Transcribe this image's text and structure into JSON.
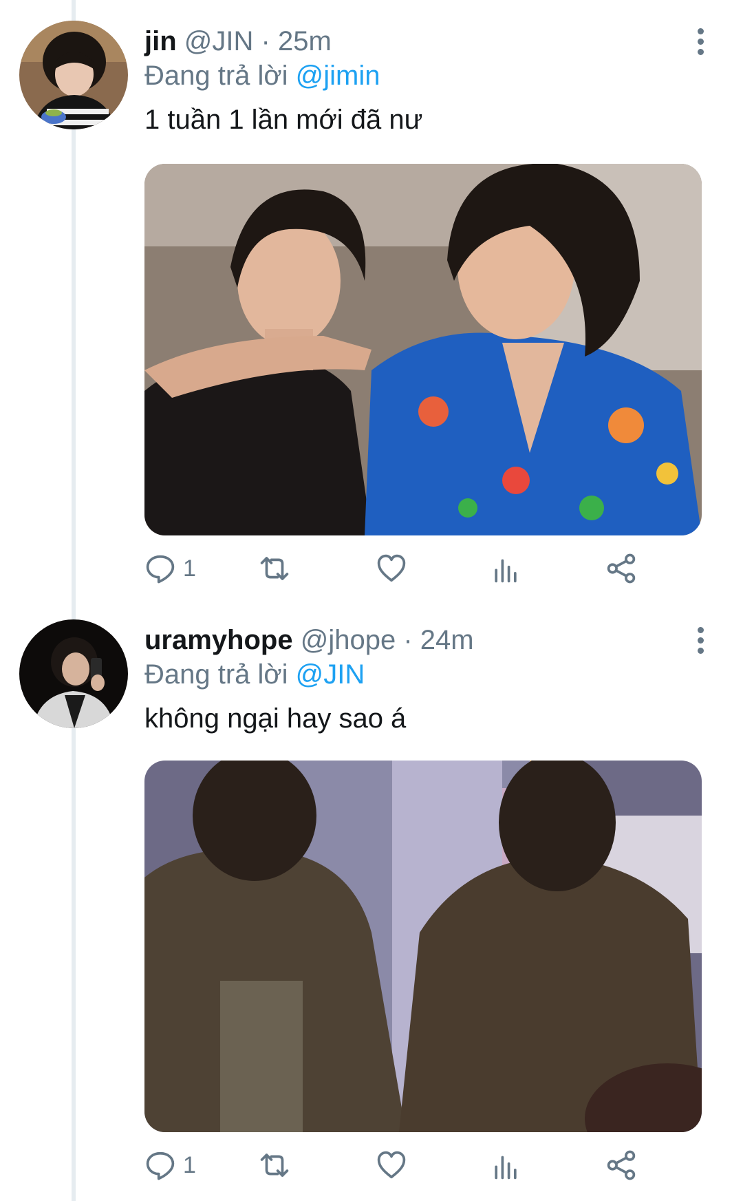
{
  "tweets": [
    {
      "name": "jin",
      "handle": "@JIN",
      "separator": "·",
      "time": "25m",
      "reply_prefix": "Đang trả lời",
      "reply_to": "@jimin",
      "text": "1 tuần 1 lần mới đã nư",
      "actions": {
        "reply_count": "1",
        "retweet_count": "",
        "like_count": "",
        "icons": [
          "reply-icon",
          "retweet-icon",
          "like-icon",
          "analytics-icon",
          "share-icon"
        ]
      },
      "media_colors": {
        "background": "#8c7e72",
        "shirt_left": "#1b1717",
        "shirt_right": "#1f5fc0",
        "skin": "#e2b79c",
        "hair": "#1e1713"
      }
    },
    {
      "name": "uramyhope",
      "handle": "@jhope",
      "separator": "·",
      "time": "24m",
      "reply_prefix": "Đang trả lời",
      "reply_to": "@JIN",
      "text": "không ngại hay sao á",
      "actions": {
        "reply_count": "1",
        "retweet_count": "",
        "like_count": "",
        "icons": [
          "reply-icon",
          "retweet-icon",
          "like-icon",
          "analytics-icon",
          "share-icon"
        ]
      },
      "media_colors": {
        "background": "#6d6a86",
        "jacket": "#4e4234",
        "hair": "#2a201a",
        "light": "#c9a9c4"
      }
    }
  ],
  "colors": {
    "accent": "#1da1f2",
    "secondary_text": "#657786",
    "primary_text": "#14171a",
    "thread_line": "#e6ecf0"
  }
}
